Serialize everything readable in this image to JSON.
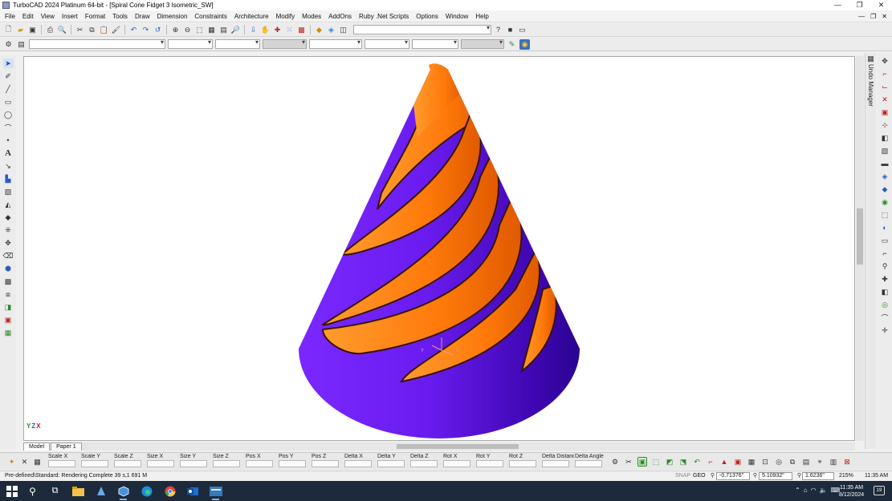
{
  "window": {
    "title": "TurboCAD 2024 Platinum 64-bit - [Spiral Cone Fidget 3 Isometric_SW]",
    "controls": [
      "—",
      "❐",
      "✕"
    ]
  },
  "menubar": {
    "items": [
      "File",
      "Edit",
      "View",
      "Insert",
      "Format",
      "Tools",
      "Draw",
      "Dimension",
      "Constraints",
      "Architecture",
      "Modify",
      "Modes",
      "AddOns",
      "Ruby .Net Scripts",
      "Options",
      "Window",
      "Help"
    ],
    "doc_controls": [
      "—",
      "❐",
      "✕"
    ]
  },
  "tabs": {
    "model": "Model",
    "paper": "Paper 1"
  },
  "undo_manager": {
    "label": "Undo Manager"
  },
  "axis_label": {
    "x": "X",
    "y": "Y",
    "z": "Z"
  },
  "inspector": {
    "fields": [
      "Scale X",
      "Scale Y",
      "Scale Z",
      "Size X",
      "Size Y",
      "Size Z",
      "Pos X",
      "Pos Y",
      "Pos Z",
      "Delta X",
      "Delta Y",
      "Delta Z",
      "Rot X",
      "Rot Y",
      "Rot Z",
      "Delta Distance",
      "Delta Angle"
    ]
  },
  "status": {
    "message": "Pre-defined\\Standard: Rendering Complete 39 s,1 691 M",
    "snap": "SNAP",
    "geo": "GEO",
    "coord_x": "-0.71376\"",
    "coord_y": "5.10932\"",
    "coord_z": "1.6236\"",
    "zoom": "215%",
    "time": "11:35 AM"
  },
  "taskbar": {
    "time": "11:35 AM",
    "date": "8/12/2024",
    "notifications": "19"
  },
  "colors": {
    "cone_blue": "#6a1cf0",
    "spiral_orange": "#ff7a0a",
    "taskbar": "#1c2a3c"
  }
}
